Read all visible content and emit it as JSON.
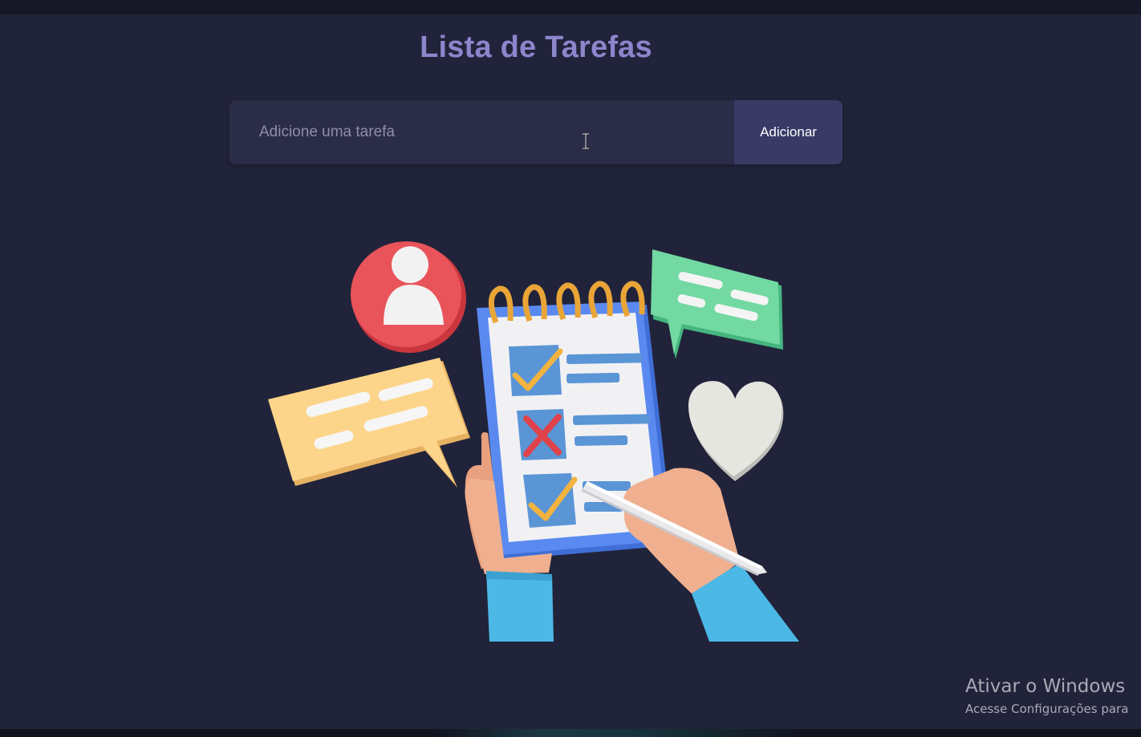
{
  "header": {
    "title": "Lista de Tarefas"
  },
  "task_form": {
    "input_placeholder": "Adicione uma tarefa",
    "input_value": "",
    "add_button_label": "Adicionar"
  },
  "illustration": {
    "icon": "todo-checklist-illustration",
    "elements": [
      "user-avatar-icon",
      "chat-bubble-green-icon",
      "chat-bubble-yellow-icon",
      "heart-icon",
      "checklist-notepad-icon",
      "pen-icon",
      "hands-icon"
    ]
  },
  "windows_watermark": {
    "title": "Ativar o Windows",
    "subtitle": "Acesse Configurações para"
  },
  "colors": {
    "background": "#21233a",
    "title": "#8c86cc",
    "input_background": "#2b2c47",
    "button_background": "#393b66",
    "button_text": "#ffffff"
  }
}
